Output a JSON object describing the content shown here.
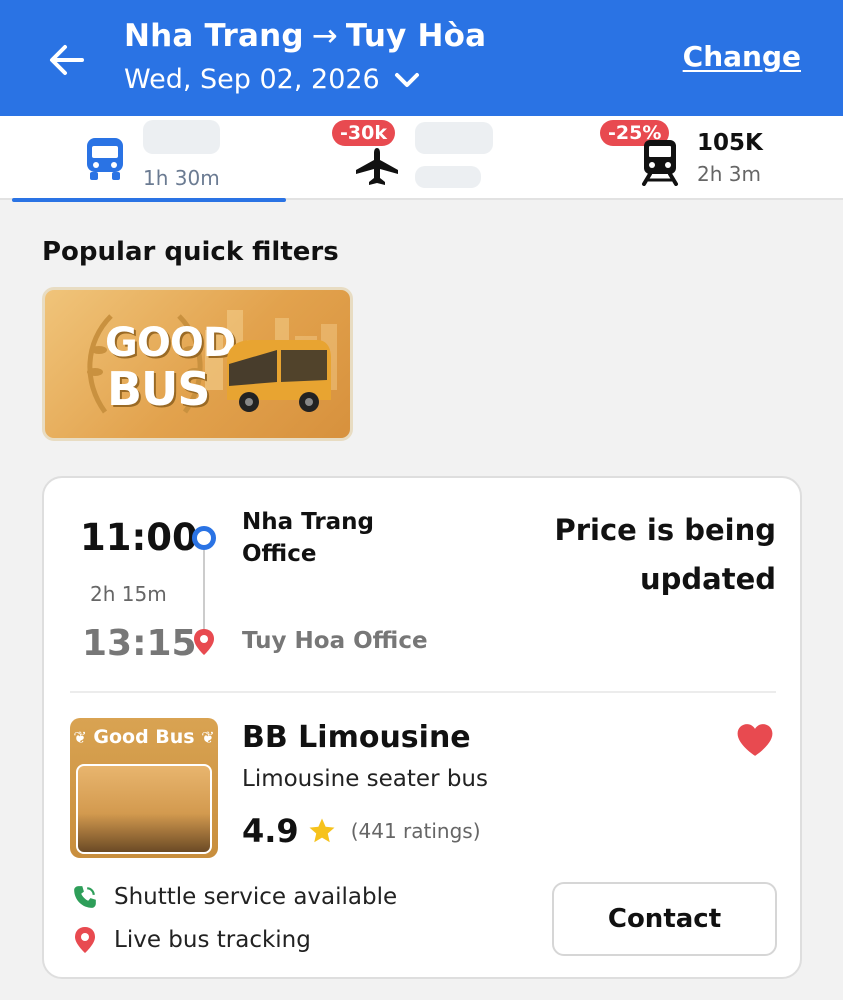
{
  "header": {
    "origin": "Nha Trang",
    "arrow": "→",
    "destination": "Tuy Hòa",
    "date": "Wed, Sep 02, 2026",
    "change_label": "Change",
    "background_color": "#2a73e4"
  },
  "tabs": {
    "bus": {
      "icon": "bus-icon",
      "duration": "1h 30m",
      "selected": true
    },
    "plane": {
      "icon": "airplane-icon",
      "discount": "-30k"
    },
    "train": {
      "icon": "train-icon",
      "discount": "-25%",
      "price": "105K",
      "duration": "2h 3m"
    }
  },
  "quick_filters": {
    "title": "Popular quick filters",
    "items": [
      {
        "text_line1": "GOOD",
        "text_line2": "BUS",
        "icon": "bus-icon"
      }
    ]
  },
  "trip": {
    "departure_time": "11:00",
    "duration": "2h 15m",
    "arrival_time": "13:15",
    "from_office": "Nha Trang Office",
    "to_office": "Tuy Hoa Office",
    "price_status": "Price is being updated",
    "operator": {
      "badge": "Good Bus",
      "name": "BB Limousine",
      "bus_type": "Limousine seater bus",
      "rating": "4.9",
      "ratings_count": "(441 ratings)",
      "favorite": true
    },
    "amenities": [
      {
        "icon": "phone-icon",
        "label": "Shuttle service available",
        "color": "#2e9e59"
      },
      {
        "icon": "location-pin-icon",
        "label": "Live bus tracking",
        "color": "#e84a50"
      }
    ],
    "contact_label": "Contact"
  }
}
